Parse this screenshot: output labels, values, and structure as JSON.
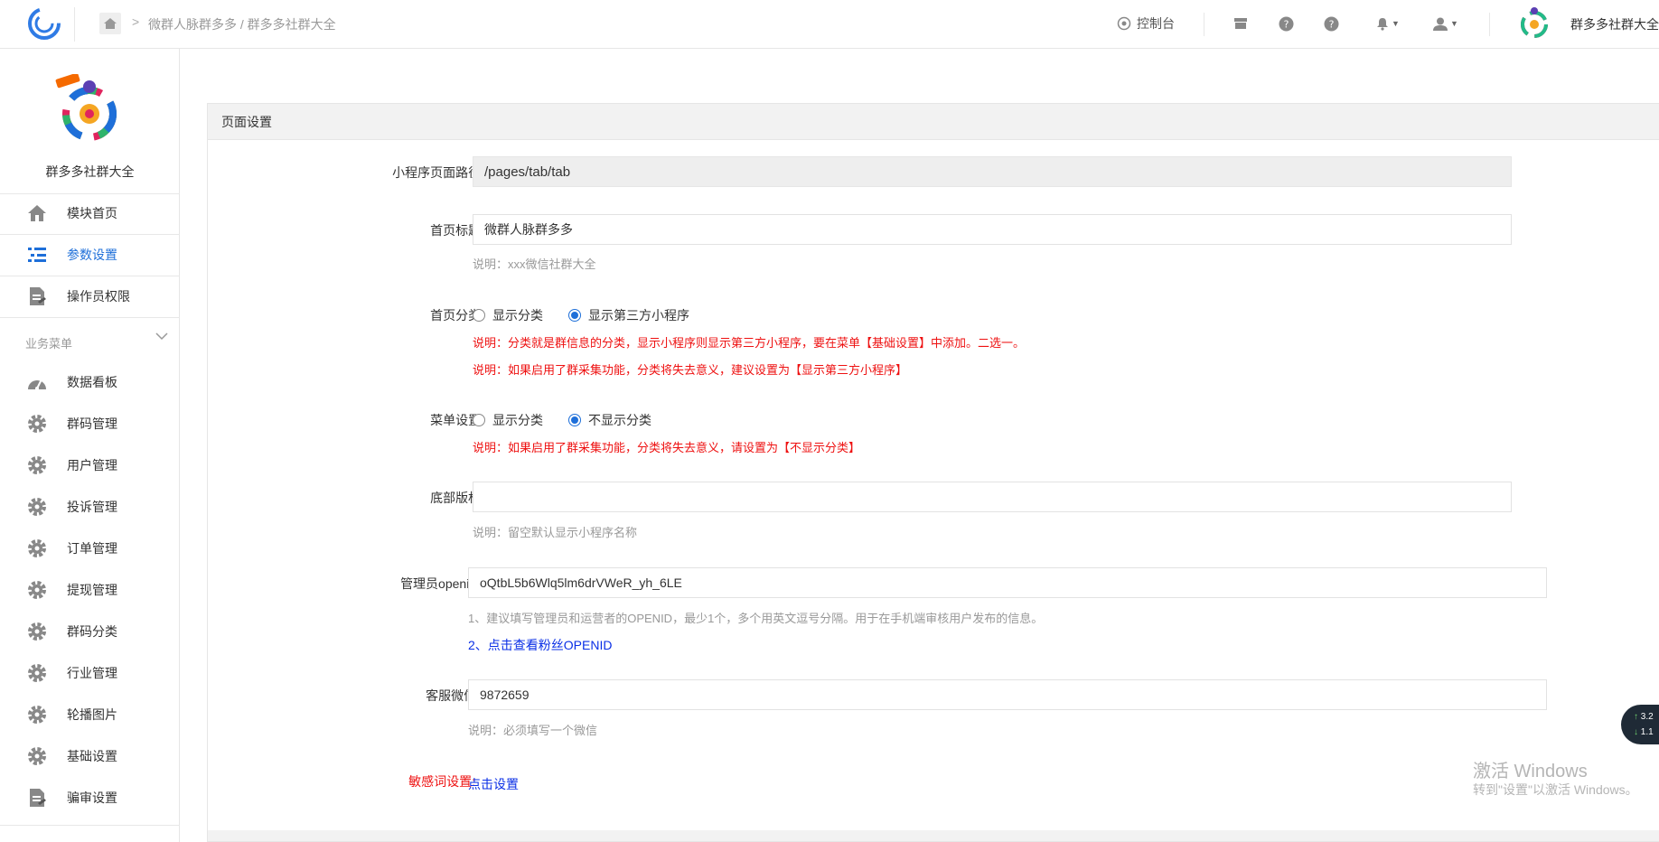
{
  "header": {
    "breadcrumb_sep": ">",
    "breadcrumb": "微群人脉群多多 / 群多多社群大全",
    "console_label": "控制台",
    "account_name": "群多多社群大全"
  },
  "sidebar": {
    "title": "群多多社群大全",
    "top_items": [
      {
        "label": "模块首页",
        "icon": "home-icon"
      },
      {
        "label": "参数设置",
        "icon": "list-icon"
      },
      {
        "label": "操作员权限",
        "icon": "document-icon"
      }
    ],
    "group_label": "业务菜单",
    "group_items": [
      {
        "label": "数据看板",
        "icon": "dashboard-icon"
      },
      {
        "label": "群码管理",
        "icon": "gear-icon"
      },
      {
        "label": "用户管理",
        "icon": "gear-icon"
      },
      {
        "label": "投诉管理",
        "icon": "gear-icon"
      },
      {
        "label": "订单管理",
        "icon": "gear-icon"
      },
      {
        "label": "提现管理",
        "icon": "gear-icon"
      },
      {
        "label": "群码分类",
        "icon": "gear-icon"
      },
      {
        "label": "行业管理",
        "icon": "gear-icon"
      },
      {
        "label": "轮播图片",
        "icon": "gear-icon"
      },
      {
        "label": "基础设置",
        "icon": "gear-icon"
      },
      {
        "label": "骗审设置",
        "icon": "document-icon"
      }
    ],
    "active_color": "#1e6fd9"
  },
  "panel": {
    "title": "页面设置",
    "path": {
      "label": "小程序页面路径:",
      "value": "/pages/tab/tab"
    },
    "home_title": {
      "label": "首页标题:",
      "value": "微群人脉群多多",
      "note": "说明：xxx微信社群大全"
    },
    "home_category": {
      "label": "首页分类:",
      "options": [
        "显示分类",
        "显示第三方小程序"
      ],
      "selected": 1,
      "note1": "说明：分类就是群信息的分类，显示小程序则显示第三方小程序，要在菜单【基础设置】中添加。二选一。",
      "note2": "说明：如果启用了群采集功能，分类将失去意义，建议设置为【显示第三方小程序】"
    },
    "menu_setting": {
      "label": "菜单设置:",
      "options": [
        "显示分类",
        "不显示分类"
      ],
      "selected": 1,
      "note": "说明：如果启用了群采集功能，分类将失去意义，请设置为【不显示分类】"
    },
    "footer_copyright": {
      "label": "底部版权:",
      "value": "",
      "note": "说明：留空默认显示小程序名称"
    },
    "admin_openid": {
      "label": "管理员openid:",
      "value": "oQtbL5b6Wlq5lm6drVWeR_yh_6LE",
      "note": "1、建议填写管理员和运营者的OPENID，最少1个，多个用英文逗号分隔。用于在手机端审核用户发布的信息。",
      "link": "2、点击查看粉丝OPENID"
    },
    "service_wechat": {
      "label": "客服微信:",
      "value": "9872659",
      "note": "说明：必须填写一个微信"
    },
    "sensitive": {
      "label": "敏感词设置:",
      "link": "点击设置"
    }
  },
  "speed_widget": {
    "up": "3.2",
    "down": "1.1"
  },
  "watermark": {
    "line1": "激活 Windows",
    "line2": "转到\"设置\"以激活 Windows。"
  },
  "colors": {
    "accent": "#1e6fd9",
    "warning": "#e11111",
    "link": "#0a2fe6"
  }
}
